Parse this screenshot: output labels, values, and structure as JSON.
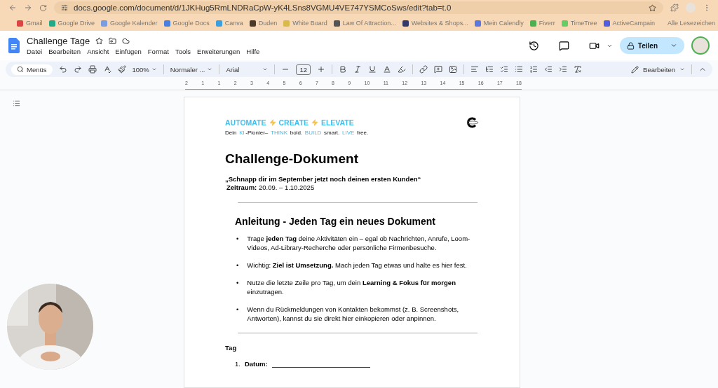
{
  "browser": {
    "url": "docs.google.com/document/d/1JKHug5RmLNDRaCpW-yK4LSns8VGMU4VE747YSMCoSws/edit?tab=t.0",
    "bookmarks": [
      "Gmail",
      "Google Drive",
      "Google Kalender",
      "Google Docs",
      "Canva",
      "Duden",
      "White Board",
      "Law Of Attraction...",
      "Websites & Shops...",
      "Mein Calendly",
      "Fiverr",
      "TimeTree",
      "ActiveCampain"
    ],
    "all_bookmarks": "Alle Lesezeichen"
  },
  "docs": {
    "title": "Challenge Tage",
    "menus": [
      "Datei",
      "Bearbeiten",
      "Ansicht",
      "Einfügen",
      "Format",
      "Tools",
      "Erweiterungen",
      "Hilfe"
    ],
    "share": "Teilen"
  },
  "toolbar": {
    "search": "Menüs",
    "zoom": "100%",
    "style": "Normaler ...",
    "font": "Arial",
    "size": "12",
    "mode": "Bearbeiten"
  },
  "ruler": [
    "2",
    "1",
    "1",
    "2",
    "3",
    "4",
    "5",
    "6",
    "7",
    "8",
    "9",
    "10",
    "11",
    "12",
    "13",
    "14",
    "15",
    "16",
    "17",
    "18"
  ],
  "document": {
    "slogan": [
      "AUTOMATE",
      "CREATE",
      "ELEVATE"
    ],
    "tagline": [
      {
        "text": "Dein ",
        "highlight": false
      },
      {
        "text": "KI",
        "highlight": true
      },
      {
        "text": "-Pionier– ",
        "highlight": false
      },
      {
        "text": "THINK",
        "highlight": true
      },
      {
        "text": " bold. ",
        "highlight": false
      },
      {
        "text": "BUILD",
        "highlight": true
      },
      {
        "text": " smart. ",
        "highlight": false
      },
      {
        "text": "LIVE",
        "highlight": true
      },
      {
        "text": " free.",
        "highlight": false
      }
    ],
    "title": "Challenge-Dokument",
    "quote": "„Schnapp dir im September jetzt noch deinen ersten Kunden“",
    "period": "**Zeitraum:** 20.09. – 1.10.2025",
    "heading": "Anleitung - Jeden Tag ein neues Dokument",
    "bullets": [
      {
        "marker": "•",
        "text": "Trage **jeden Tag** deine Aktivitäten ein – egal ob Nachrichten, Anrufe, Loom-Videos, Ad-Library-Recherche oder persönliche Firmenbesuche."
      },
      {
        "marker": "•",
        "text": "Wichtig: **Ziel ist Umsetzung.** Mach jeden Tag etwas und halte es hier fest."
      },
      {
        "marker": "•",
        "text": "Nutze die letzte Zeile pro Tag, um dein **Learning & Fokus für morgen** einzutragen."
      },
      {
        "marker": "•",
        "text": "Wenn du Rückmeldungen von Kontakten bekommst (z. B. Screenshots, Antworten), kannst du sie direkt hier einkopieren oder anpinnen."
      }
    ],
    "section": "Tag",
    "numbered": [
      {
        "number": "1.",
        "label": "Datum:"
      }
    ]
  }
}
